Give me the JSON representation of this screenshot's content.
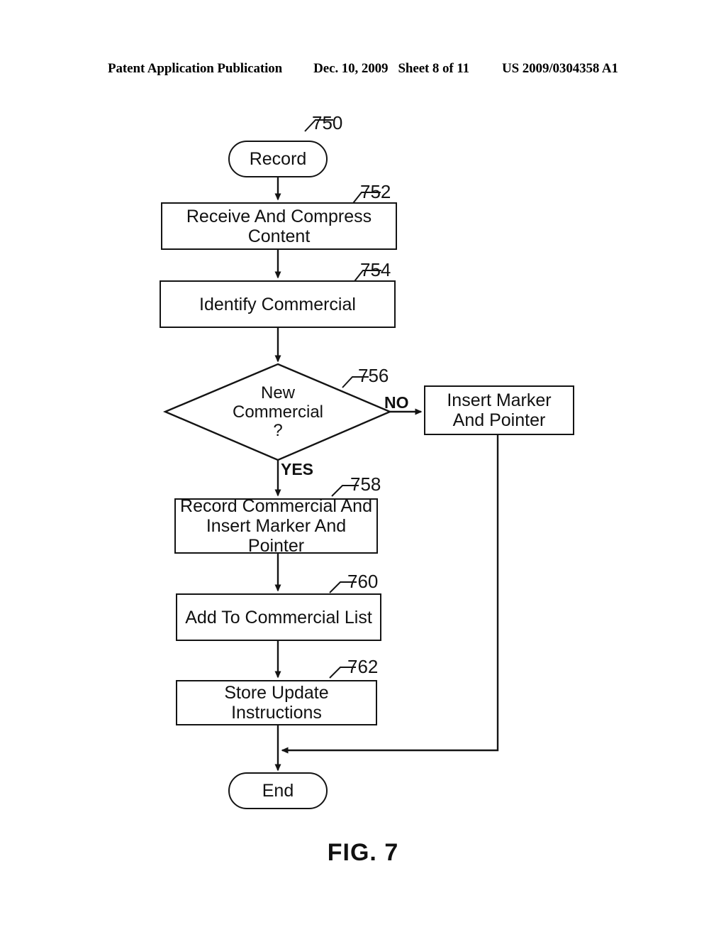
{
  "header": {
    "publication": "Patent Application Publication",
    "date": "Dec. 10, 2009",
    "sheet": "Sheet 8 of 11",
    "patent_number": "US 2009/0304358 A1"
  },
  "figure": {
    "caption": "FIG. 7",
    "title": "Record process flowchart",
    "nodes": [
      {
        "id": "start",
        "ref": "750",
        "type": "terminal",
        "label": "Record"
      },
      {
        "id": "receive",
        "ref": "752",
        "type": "process",
        "label": "Receive And Compress Content"
      },
      {
        "id": "identify",
        "ref": "754",
        "type": "process",
        "label": "Identify Commercial"
      },
      {
        "id": "decision",
        "ref": "756",
        "type": "decision",
        "label_line1": "New",
        "label_line2": "Commercial",
        "label_line3": "?"
      },
      {
        "id": "insert",
        "ref": "",
        "type": "process",
        "label_line1": "Insert Marker",
        "label_line2": "And Pointer"
      },
      {
        "id": "record_ins",
        "ref": "758",
        "type": "process",
        "label_line1": "Record Commercial And",
        "label_line2": "Insert Marker And Pointer"
      },
      {
        "id": "add_list",
        "ref": "760",
        "type": "process",
        "label": "Add To Commercial List"
      },
      {
        "id": "store_update",
        "ref": "762",
        "type": "process",
        "label": "Store Update Instructions"
      },
      {
        "id": "end",
        "ref": "",
        "type": "terminal",
        "label": "End"
      }
    ],
    "branch_labels": {
      "no": "NO",
      "yes": "YES"
    },
    "colors": {
      "ink": "#141414",
      "page": "#ffffff"
    }
  }
}
